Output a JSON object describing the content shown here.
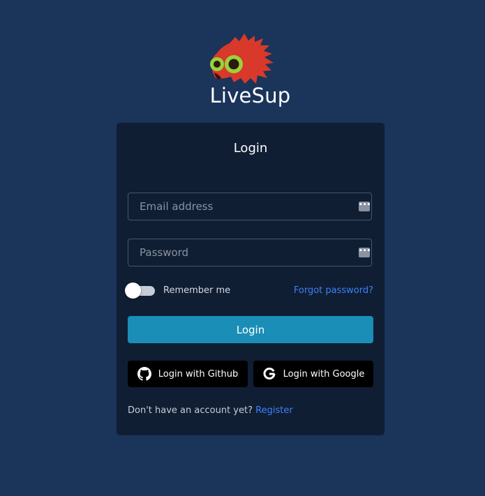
{
  "brand": {
    "name": "LiveSup",
    "logo_icon": "red-spiky-creature-logo"
  },
  "login_card": {
    "title": "Login",
    "email_placeholder": "Email address",
    "password_placeholder": "Password",
    "password_manager_icon": "password-dots-icon",
    "password_manager_glyph": "•••",
    "remember_label": "Remember me",
    "remember_checked": false,
    "forgot_link": "Forgot password?",
    "login_button": "Login",
    "github_button": "Login with Github",
    "google_button": "Login with Google",
    "footer_text": "Don't have an account yet?",
    "register_link": "Register"
  },
  "colors": {
    "page_background": "#1a345a",
    "card_background": "#101e34",
    "primary_button": "#1a8eb7",
    "link": "#3b82f6",
    "oauth_button": "#000000",
    "logo_red": "#d8392b",
    "logo_eye_green": "#9ad23a"
  }
}
